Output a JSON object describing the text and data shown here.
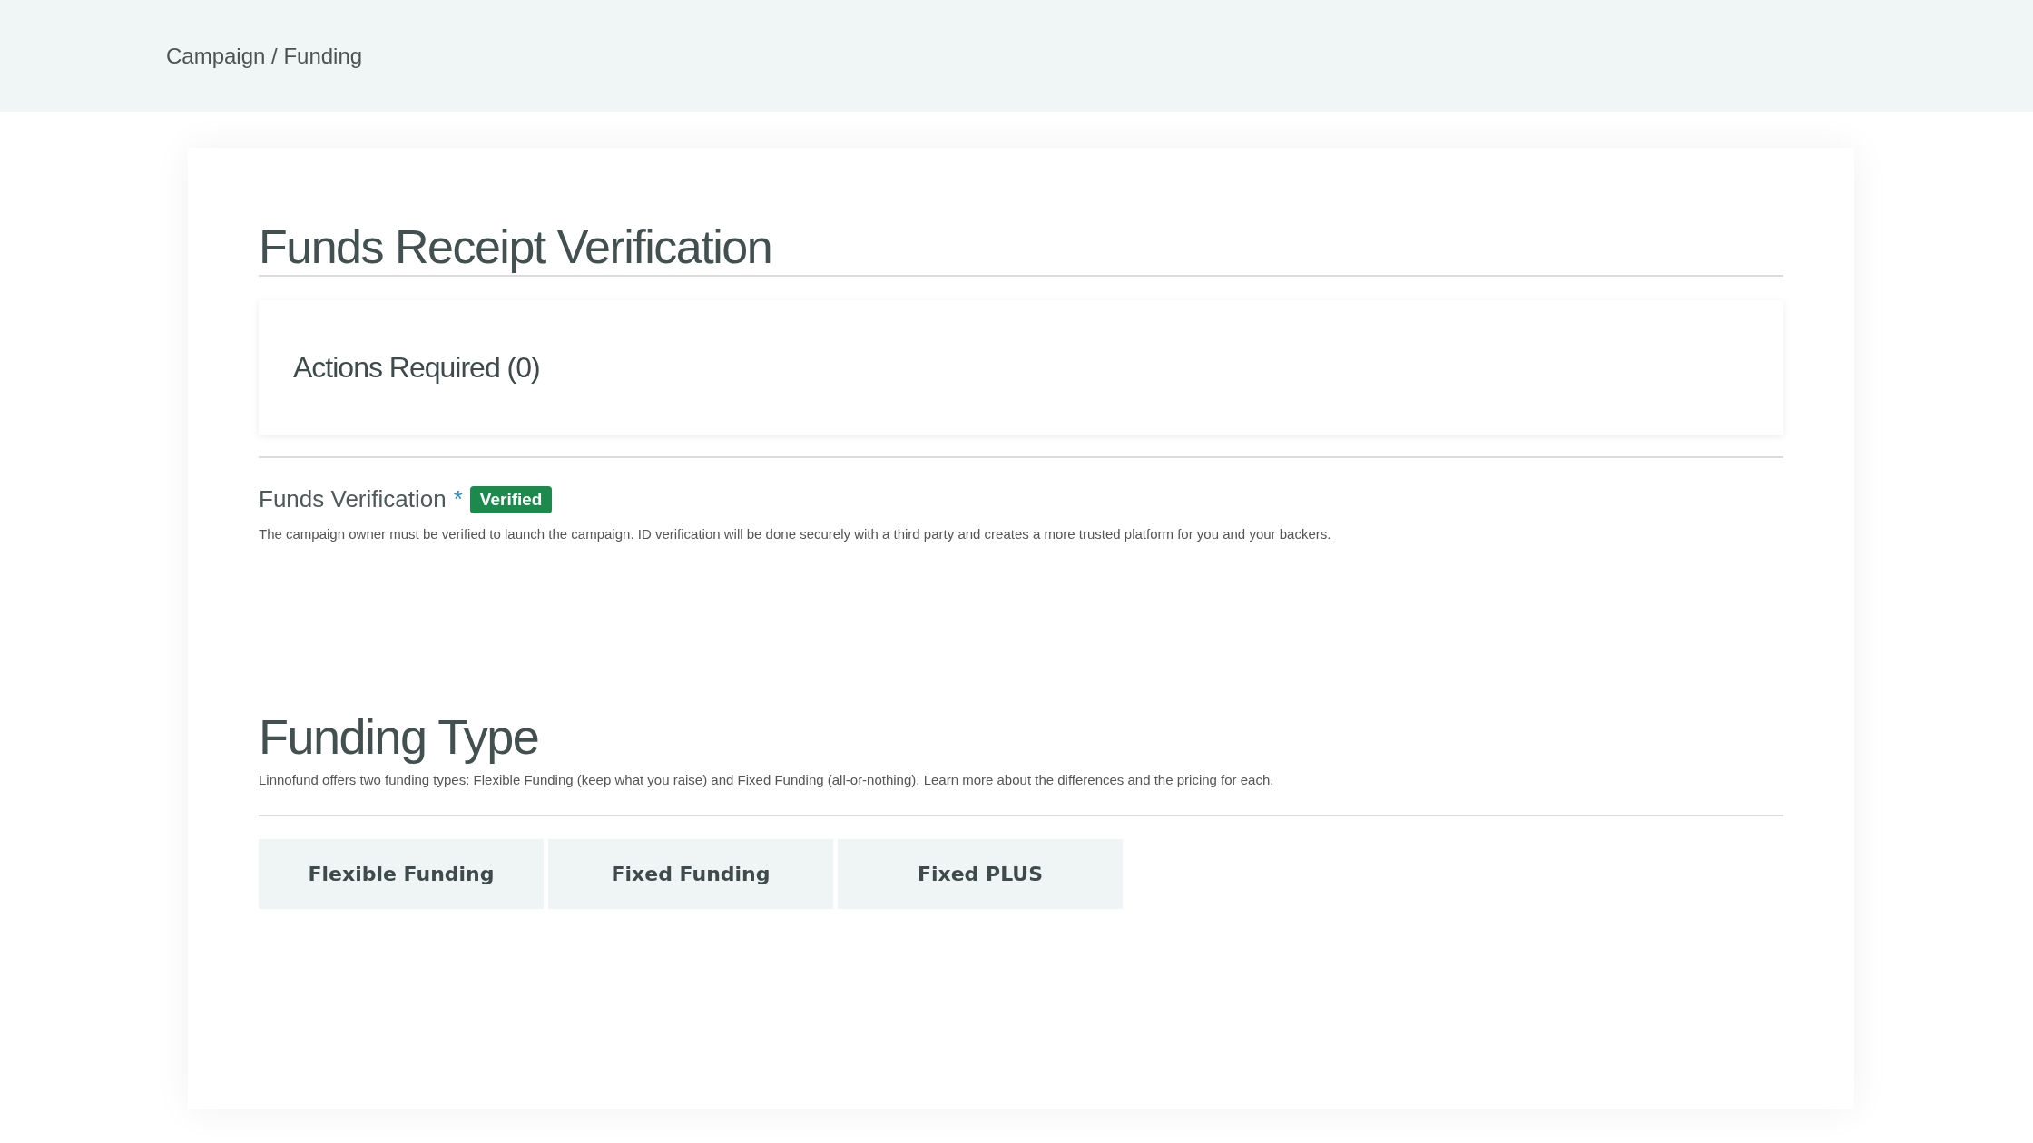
{
  "breadcrumb": "Campaign / Funding",
  "title": "Funds Receipt Verification",
  "actions_panel": {
    "title": "Actions Required (0)"
  },
  "funds_verification": {
    "label": "Funds Verification",
    "required_mark": "*",
    "badge": "Verified",
    "description": "The campaign owner must be verified to launch the campaign. ID verification will be done securely with a third party and creates a more trusted platform for you and your backers."
  },
  "funding_type": {
    "title": "Funding Type",
    "description": "Linnofund offers two funding types: Flexible Funding (keep what you raise) and Fixed Funding (all-or-nothing). Learn more about the differences and the pricing for each.",
    "tabs": [
      {
        "label": "Flexible Funding",
        "selected": false
      },
      {
        "label": "Fixed Funding",
        "selected": false
      },
      {
        "label": "Fixed PLUS",
        "selected": false
      }
    ]
  }
}
